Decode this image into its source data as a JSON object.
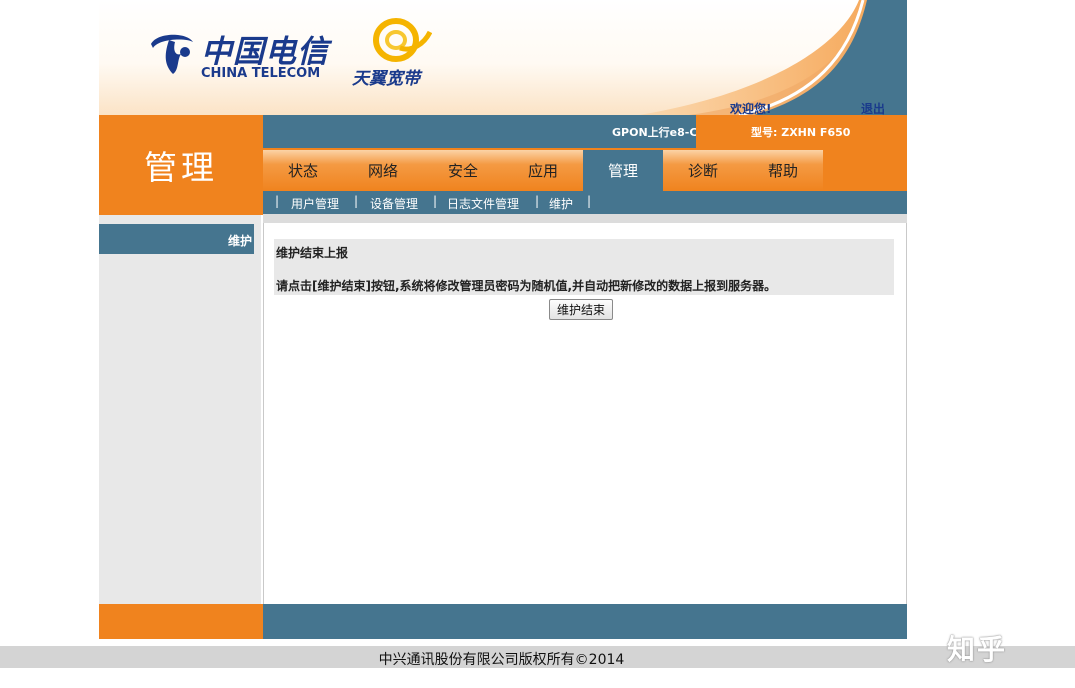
{
  "header": {
    "brand_cn": "中国电信",
    "brand_en": "CHINA TELECOM",
    "brand2": "天翼宽带",
    "welcome": "欢迎您!",
    "logout": "退出"
  },
  "left_title": "管理",
  "infobar": {
    "device_name": "GPON上行e8-C",
    "model": "型号: ZXHN F650"
  },
  "tabs": [
    {
      "label": "状态",
      "active": false
    },
    {
      "label": "网络",
      "active": false
    },
    {
      "label": "安全",
      "active": false
    },
    {
      "label": "应用",
      "active": false
    },
    {
      "label": "管理",
      "active": true
    },
    {
      "label": "诊断",
      "active": false
    },
    {
      "label": "帮助",
      "active": false
    }
  ],
  "subnav": {
    "separator": "|",
    "items": [
      "用户管理",
      "设备管理",
      "日志文件管理",
      "维护"
    ]
  },
  "sidebar": {
    "items": [
      "维护"
    ]
  },
  "content": {
    "panel_title": "维护结束上报",
    "panel_desc": "请点击[维护结束]按钮,系统将修改管理员密码为随机值,并自动把新修改的数据上报到服务器。",
    "button_label": "维护结束"
  },
  "footer": {
    "copyright": "中兴通讯股份有限公司版权所有©2014"
  },
  "watermark": "知乎",
  "colors": {
    "orange": "#f0831e",
    "steel_blue": "#45758f",
    "brand_blue": "#1a3a8c"
  }
}
